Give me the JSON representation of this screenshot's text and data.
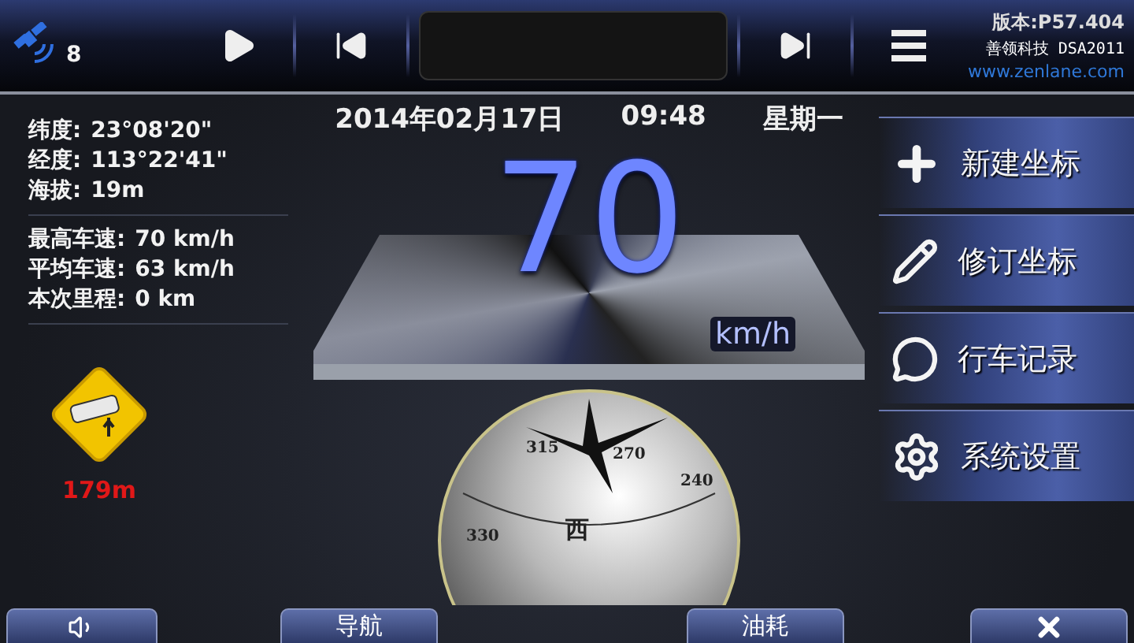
{
  "top_bar": {
    "satellite_count": "8",
    "version": "版本:P57.404",
    "brand": "善领科技 DSA2011",
    "url": "www.zenlane.com"
  },
  "position": [
    {
      "label": "纬度:",
      "value": "23°08'20\""
    },
    {
      "label": "经度:",
      "value": "113°22'41\""
    },
    {
      "label": "海拔:",
      "value": "19m"
    }
  ],
  "trip": [
    {
      "label": "最高车速:",
      "value": "70 km/h"
    },
    {
      "label": "平均车速:",
      "value": "63 km/h"
    },
    {
      "label": "本次里程:",
      "value": "0 km"
    }
  ],
  "camera_warning": {
    "distance": "179m"
  },
  "clock": {
    "date": "2014年02月17日",
    "time": "09:48",
    "weekday": "星期一"
  },
  "speed": {
    "value": "70",
    "unit": "km/h"
  },
  "compass": {
    "labels": [
      "315",
      "270",
      "330",
      "240",
      "西"
    ]
  },
  "menu": [
    {
      "kind": "add",
      "label": "新建坐标"
    },
    {
      "kind": "edit",
      "label": "修订坐标"
    },
    {
      "kind": "log",
      "label": "行车记录"
    },
    {
      "kind": "settings",
      "label": "系统设置"
    }
  ],
  "bottom_bar": {
    "buttons": [
      "导航",
      "油耗"
    ]
  }
}
